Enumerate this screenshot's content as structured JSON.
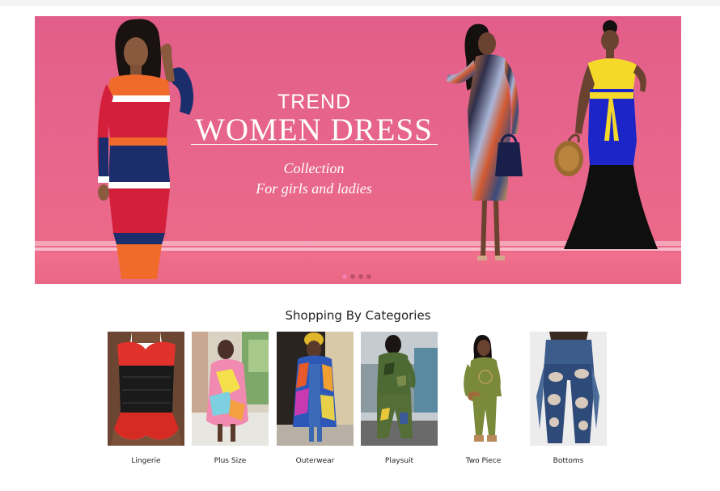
{
  "banner": {
    "line1": "TREND",
    "line2": "WOMEN DRESS",
    "line3": "Collection",
    "line4": "For girls and ladies",
    "slides": 4,
    "active_slide": 1
  },
  "categories": {
    "title": "Shopping By Categories",
    "items": [
      {
        "label": "Lingerie"
      },
      {
        "label": "Plus Size"
      },
      {
        "label": "Outerwear"
      },
      {
        "label": "Playsuit"
      },
      {
        "label": "Two Piece"
      },
      {
        "label": "Bottoms"
      }
    ]
  },
  "colors": {
    "banner_pink": "#e25e8a",
    "dot_active": "#f47fb0"
  }
}
